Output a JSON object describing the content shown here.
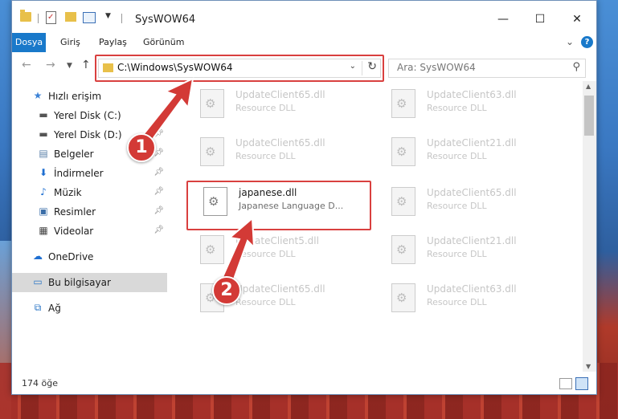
{
  "window": {
    "title": "SysWOW64"
  },
  "ribbon": {
    "tabs": [
      "Dosya",
      "Giriş",
      "Paylaş",
      "Görünüm"
    ]
  },
  "address": {
    "path": "C:\\Windows\\SysWOW64"
  },
  "search": {
    "placeholder": "Ara: SysWOW64"
  },
  "sidebar": {
    "items": [
      {
        "label": "Hızlı erişim",
        "icon": "star-icon"
      },
      {
        "label": "Yerel Disk (C:)",
        "icon": "drive-icon"
      },
      {
        "label": "Yerel Disk (D:)",
        "icon": "drive-icon"
      },
      {
        "label": "Belgeler",
        "icon": "documents-icon"
      },
      {
        "label": "İndirmeler",
        "icon": "download-icon"
      },
      {
        "label": "Müzik",
        "icon": "music-icon"
      },
      {
        "label": "Resimler",
        "icon": "pictures-icon"
      },
      {
        "label": "Videolar",
        "icon": "video-icon"
      },
      {
        "label": "OneDrive",
        "icon": "cloud-icon"
      },
      {
        "label": "Bu bilgisayar",
        "icon": "computer-icon"
      },
      {
        "label": "Ağ",
        "icon": "network-icon"
      }
    ]
  },
  "files": [
    {
      "name": "UpdateClient65.dll",
      "desc": "Resource DLL"
    },
    {
      "name": "UpdateClient63.dll",
      "desc": "Resource DLL"
    },
    {
      "name": "UpdateClient65.dll",
      "desc": "Resource DLL"
    },
    {
      "name": "UpdateClient21.dll",
      "desc": "Resource DLL"
    },
    {
      "name": "japanese.dll",
      "desc": "Japanese Language D..."
    },
    {
      "name": "UpdateClient65.dll",
      "desc": "Resource DLL"
    },
    {
      "name": "UpdateClient5.dll",
      "desc": "Resource DLL"
    },
    {
      "name": "UpdateClient21.dll",
      "desc": "Resource DLL"
    },
    {
      "name": "UpdateClient65.dll",
      "desc": "Resource DLL"
    },
    {
      "name": "UpdateClient63.dll",
      "desc": "Resource DLL"
    }
  ],
  "status": {
    "count": "174 öğe"
  },
  "callouts": {
    "one": "1",
    "two": "2"
  },
  "colors": {
    "accent": "#1979ca",
    "highlight": "#d9403f"
  }
}
